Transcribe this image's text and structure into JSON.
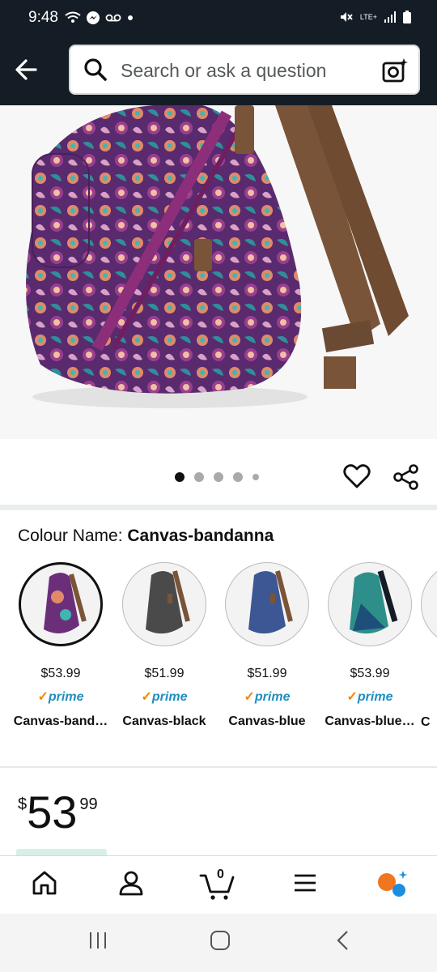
{
  "status_bar": {
    "time": "9:48",
    "network": "LTE+"
  },
  "search": {
    "placeholder": "Search or ask a question"
  },
  "colour": {
    "label": "Colour Name: ",
    "value": "Canvas-bandanna"
  },
  "swatches": [
    {
      "price": "$53.99",
      "prime": "prime",
      "name": "Canvas-band…",
      "color": "#6b2f7a"
    },
    {
      "price": "$51.99",
      "prime": "prime",
      "name": "Canvas-black",
      "color": "#4a4a4a"
    },
    {
      "price": "$51.99",
      "prime": "prime",
      "name": "Canvas-blue",
      "color": "#3d5794"
    },
    {
      "price": "$53.99",
      "prime": "prime",
      "name": "Canvas-blue…",
      "color": "#2e8f8a"
    },
    {
      "name": "C"
    }
  ],
  "price": {
    "currency": "$",
    "whole": "53",
    "fraction": "99"
  },
  "nav": {
    "cart_count": "0"
  },
  "colors": {
    "header_bg": "#141d26",
    "prime_blue": "#1f8ebd",
    "prime_check": "#f08804",
    "rufus_orange": "#f0761f",
    "rufus_blue": "#1a8fe0"
  }
}
